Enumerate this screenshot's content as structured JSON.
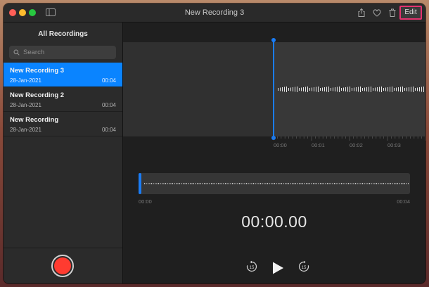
{
  "window": {
    "title": "New Recording 3"
  },
  "toolbar": {
    "edit_label": "Edit"
  },
  "sidebar": {
    "heading": "All Recordings",
    "search_placeholder": "Search",
    "recordings": [
      {
        "name": "New Recording 3",
        "date": "28-Jan-2021",
        "duration": "00:04",
        "selected": true
      },
      {
        "name": "New Recording 2",
        "date": "28-Jan-2021",
        "duration": "00:04",
        "selected": false
      },
      {
        "name": "New Recording",
        "date": "28-Jan-2021",
        "duration": "00:04",
        "selected": false
      }
    ]
  },
  "waveform": {
    "tick_labels": [
      "00:00",
      "00:01",
      "00:02",
      "00:03"
    ]
  },
  "overview": {
    "start_label": "00:00",
    "end_label": "00:04"
  },
  "player": {
    "time": "00:00.00",
    "skip_back_label": "15",
    "skip_forward_label": "15"
  },
  "colors": {
    "accent": "#0a84ff",
    "record": "#ff3b30",
    "highlight": "#e4336f"
  }
}
